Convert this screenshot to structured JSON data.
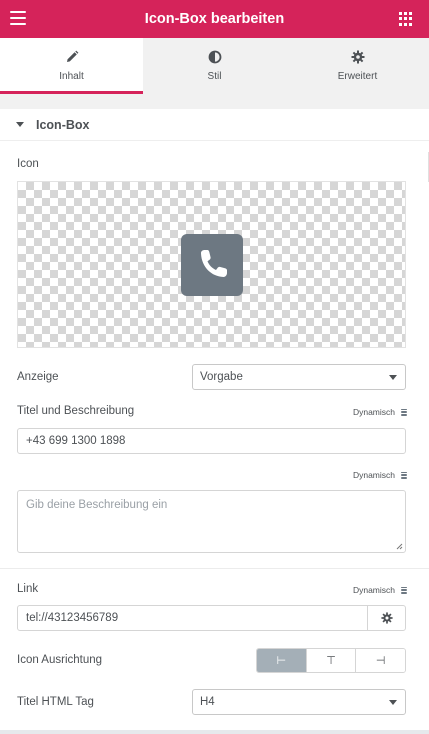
{
  "header": {
    "title": "Icon-Box bearbeiten",
    "menu_icon": "hamburger-icon",
    "apps_icon": "grid-icon"
  },
  "tabs": [
    {
      "label": "Inhalt",
      "icon": "pencil-icon",
      "active": true
    },
    {
      "label": "Stil",
      "icon": "contrast-icon",
      "active": false
    },
    {
      "label": "Erweitert",
      "icon": "gear-icon",
      "active": false
    }
  ],
  "section": {
    "title": "Icon-Box"
  },
  "icon_field": {
    "label": "Icon",
    "selected_icon": "phone-square-icon"
  },
  "anzeige": {
    "label": "Anzeige",
    "value": "Vorgabe"
  },
  "titel": {
    "label": "Titel und Beschreibung",
    "dynamic": "Dynamisch",
    "value": "+43 699 1300 1898"
  },
  "beschreibung": {
    "dynamic": "Dynamisch",
    "placeholder": "Gib deine Beschreibung ein"
  },
  "link": {
    "label": "Link",
    "dynamic": "Dynamisch",
    "value": "tel://43123456789"
  },
  "ausrichtung": {
    "label": "Icon Ausrichtung",
    "options": [
      {
        "glyph": "⊢",
        "active": true
      },
      {
        "glyph": "⊤",
        "active": false
      },
      {
        "glyph": "⊣",
        "active": false
      }
    ]
  },
  "html_tag": {
    "label": "Titel HTML Tag",
    "value": "H4"
  },
  "colors": {
    "brand": "#d5235a",
    "icon_bg": "#6d7882",
    "active_toggle": "#a4afb7"
  }
}
